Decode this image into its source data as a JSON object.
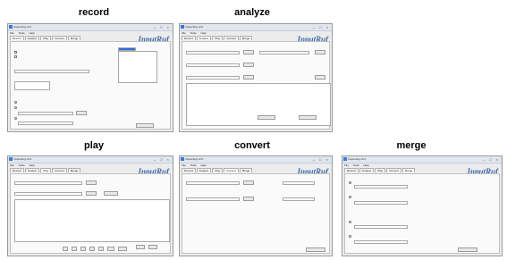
{
  "captions": [
    "record",
    "analyze",
    "play",
    "convert",
    "merge"
  ],
  "window": {
    "title": "Inspectlog v2.0",
    "menu": [
      "File",
      "Tools",
      "Help"
    ],
    "brand": "InputRuf",
    "tabs": [
      "Record",
      "Analyze",
      "Play",
      "Convert",
      "Merge"
    ]
  }
}
